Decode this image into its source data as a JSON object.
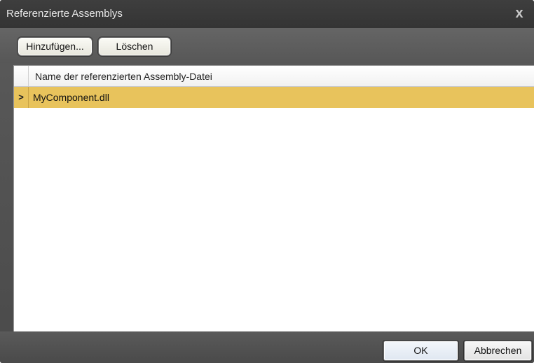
{
  "window": {
    "title": "Referenzierte Assemblys",
    "close_glyph": "x"
  },
  "toolbar": {
    "add_label": "Hinzufügen...",
    "delete_label": "Löschen"
  },
  "grid": {
    "column_header": "Name der referenzierten Assembly-Datei",
    "rows": [
      {
        "indicator": ">",
        "name": "MyComponent.dll",
        "selected": true
      }
    ],
    "colors": {
      "selected_row": "#e8c35c"
    }
  },
  "footer": {
    "ok_label": "OK",
    "cancel_label": "Abbrechen"
  }
}
